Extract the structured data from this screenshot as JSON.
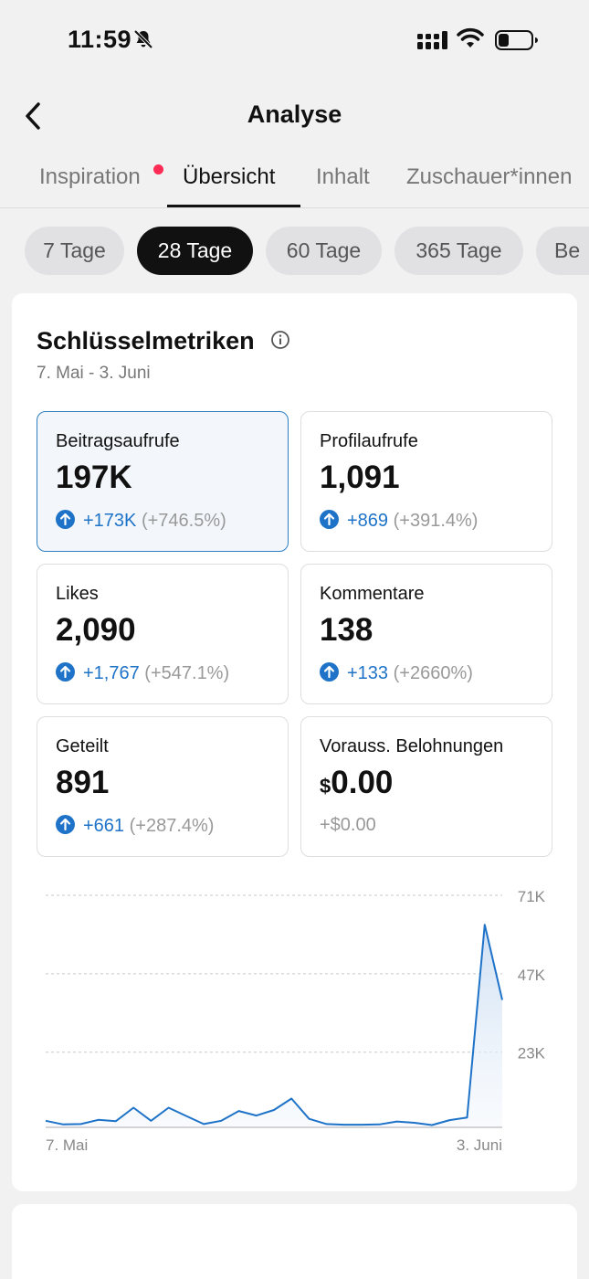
{
  "status_bar": {
    "time": "11:59",
    "icons": [
      "bell-slash-icon",
      "signal-icon",
      "wifi-icon",
      "battery-icon"
    ]
  },
  "header": {
    "title": "Analyse",
    "back_icon": "chevron-left-icon"
  },
  "tabs": [
    {
      "label": "Inspiration",
      "has_dot": true
    },
    {
      "label": "Übersicht",
      "active": true
    },
    {
      "label": "Inhalt"
    },
    {
      "label": "Zuschauer*innen"
    }
  ],
  "ranges": [
    {
      "label": "7 Tage"
    },
    {
      "label": "28 Tage",
      "active": true
    },
    {
      "label": "60 Tage"
    },
    {
      "label": "365 Tage"
    },
    {
      "label": "Be"
    }
  ],
  "metrics_card": {
    "title": "Schlüsselmetriken",
    "date_range": "7. Mai - 3. Juni",
    "metrics": [
      {
        "label": "Beitragsaufrufe",
        "value": "197K",
        "delta": "+173K",
        "pct": "(+746.5%)",
        "selected": true
      },
      {
        "label": "Profilaufrufe",
        "value": "1,091",
        "delta": "+869",
        "pct": "(+391.4%)"
      },
      {
        "label": "Likes",
        "value": "2,090",
        "delta": "+1,767",
        "pct": "(+547.1%)"
      },
      {
        "label": "Kommentare",
        "value": "138",
        "delta": "+133",
        "pct": "(+2660%)"
      },
      {
        "label": "Geteilt",
        "value": "891",
        "delta": "+661",
        "pct": "(+287.4%)"
      },
      {
        "label": "Vorauss. Belohnungen",
        "currency": "$",
        "value": "0.00",
        "delta": "+$0.00"
      }
    ]
  },
  "colors": {
    "accent_blue": "#1e73c8",
    "tab_dot": "#fe2c55",
    "selected_border": "#2d7fc1"
  },
  "chart_data": {
    "type": "area",
    "x_start_label": "7. Mai",
    "x_end_label": "3. Juni",
    "y_ticks": [
      {
        "value": 23000,
        "label": "23K"
      },
      {
        "value": 47000,
        "label": "47K"
      },
      {
        "value": 71000,
        "label": "71K"
      }
    ],
    "ylim": [
      0,
      71000
    ],
    "grid": "dashed",
    "y_axis_position": "right",
    "values": [
      2000,
      900,
      1000,
      2300,
      1900,
      6000,
      2000,
      6000,
      3500,
      1000,
      2000,
      5000,
      3600,
      5300,
      8800,
      2600,
      1000,
      800,
      800,
      900,
      1800,
      1400,
      700,
      2200,
      3000,
      62000,
      39000
    ]
  }
}
